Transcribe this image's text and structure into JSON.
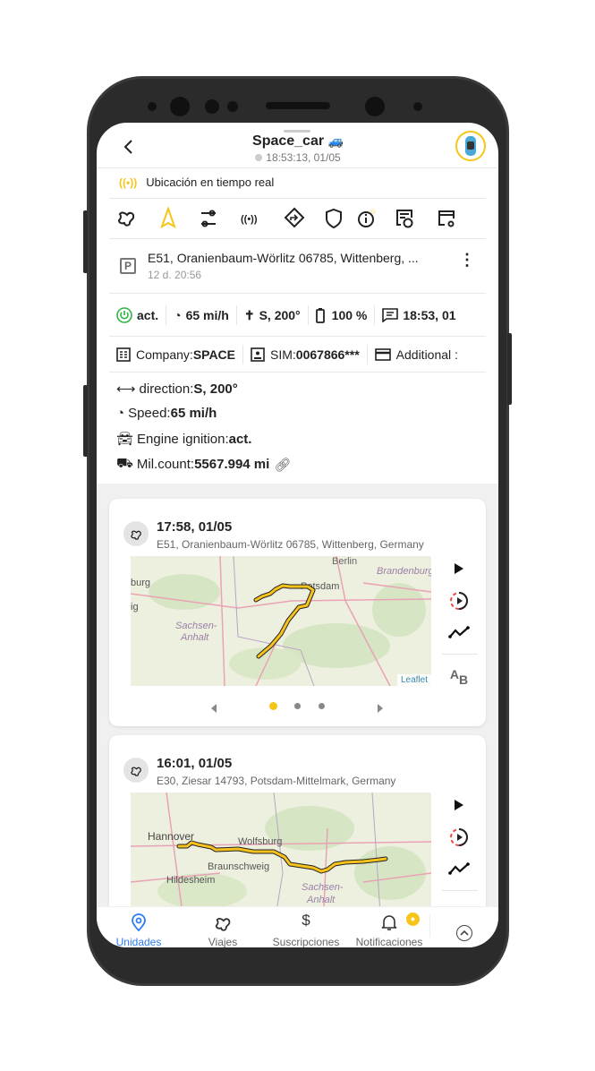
{
  "header": {
    "title": "Space_car",
    "title_emoji": "🚙",
    "timestamp": "18:53:13, 01/05"
  },
  "live": {
    "label": "Ubicación en tiempo real"
  },
  "toolbar": {
    "icons": [
      "trip-icon",
      "navigate-arrow-icon",
      "route-settings-icon",
      "broadcast-icon",
      "directions-icon",
      "shield-icon",
      "info-star-icon",
      "report-clock-icon",
      "window-settings-icon"
    ]
  },
  "address": {
    "text": "E51, Oranienbaum-Wörlitz 06785, Wittenberg, ...",
    "sub": "12 d. 20:56"
  },
  "stats": {
    "ignition": "act.",
    "speed": "65 mi/h",
    "direction": "S, 200°",
    "battery": "100 %",
    "message": "18:53, 01"
  },
  "info": {
    "company_label": "Company: ",
    "company": "SPACE",
    "sim_label": "SIM: ",
    "sim": "0067866***",
    "additional": "Additional :"
  },
  "details": [
    {
      "label": "direction: ",
      "value": "S, 200°"
    },
    {
      "label": "Speed: ",
      "value": "65 mi/h"
    },
    {
      "label": "Engine ignition: ",
      "value": "act."
    },
    {
      "label": "Mil.count: ",
      "value": "5567.994 mi"
    }
  ],
  "trips": [
    {
      "time": "17:58, 01/05",
      "address": "E51, Oranienbaum-Wörlitz 06785, Wittenberg, Germany",
      "map_labels": [
        "Berlin",
        "Brandenburg",
        "Potsdam",
        "burg",
        "Sachsen-",
        "Anhalt",
        "ig"
      ],
      "attribution": "Leaflet",
      "page": 1,
      "pages": 3
    },
    {
      "time": "16:01, 01/05",
      "address": "E30, Ziesar 14793, Potsdam-Mittelmark, Germany",
      "map_labels": [
        "Hannover",
        "Wolfsburg",
        "Braunschweig",
        "Hildesheim",
        "Sachsen-",
        "Anhalt"
      ]
    }
  ],
  "trip_controls": {
    "ab_label": "A",
    "ab_sub": "B"
  },
  "nav": {
    "items": [
      {
        "label": "Unidades",
        "active": true
      },
      {
        "label": "Viajes"
      },
      {
        "label": "Suscripciones"
      },
      {
        "label": "Notificaciones"
      }
    ]
  },
  "colors": {
    "accent": "#f5c518",
    "active_nav": "#2f7cf6",
    "route": "#f7c21b",
    "ignition_on": "#2fb344"
  }
}
